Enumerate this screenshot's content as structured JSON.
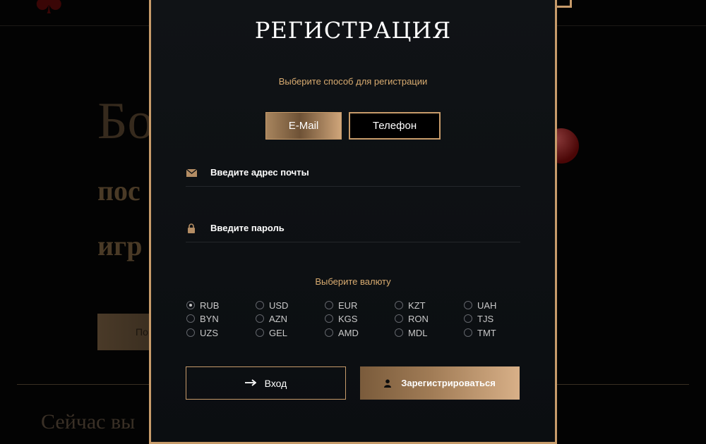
{
  "background": {
    "logo_glyph": "♣",
    "hero_title": "Бо",
    "hero_line1": "пос",
    "hero_line2": "игр",
    "button_fragment": "По",
    "footer_text": "Сейчас вы"
  },
  "modal": {
    "title": "РЕГИСТРАЦИЯ",
    "subtitle": "Выберите способ для регистрации",
    "methods": {
      "email": "E-Mail",
      "phone": "Телефон",
      "active": "email"
    },
    "fields": {
      "email_placeholder": "Введите адрес почты",
      "password_placeholder": "Введите пароль"
    },
    "currency_title": "Выберите валюту",
    "currencies": {
      "rub": "RUB",
      "usd": "USD",
      "eur": "EUR",
      "kzt": "KZT",
      "uah": "UAH",
      "byn": "BYN",
      "azn": "AZN",
      "kgs": "KGS",
      "ron": "RON",
      "tjs": "TJS",
      "uzs": "UZS",
      "gel": "GEL",
      "amd": "AMD",
      "mdl": "MDL",
      "tmt": "TMT"
    },
    "selected_currency": "RUB",
    "login_label": "Вход",
    "register_label": "Зарегистрироваться"
  },
  "colors": {
    "accent_gold": "#c79b6a",
    "label_gold": "#d8ab70",
    "modal_bg": "#0d1014"
  },
  "icons": {
    "email": "envelope-icon",
    "password": "lock-icon",
    "login": "arrow-right-icon",
    "register": "user-icon"
  }
}
